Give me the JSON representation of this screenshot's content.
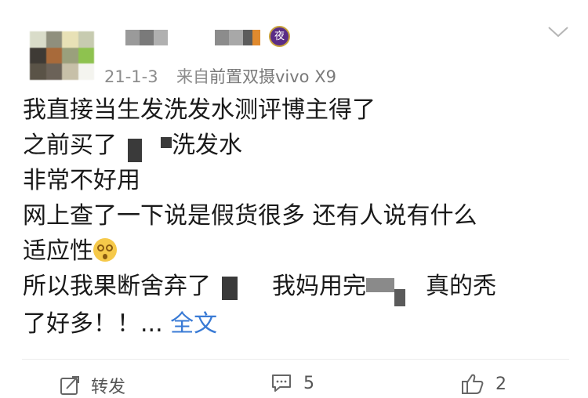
{
  "post": {
    "date": "21-1-3",
    "source_prefix": "来自",
    "source_device": "前置双摄vivo X9",
    "line1": "我直接当生发洗发水测评博主得了",
    "line2_pre": "之前买了",
    "line2_post": "洗发水",
    "line3": "非常不好用",
    "line4": "网上查了一下说是假货很多 还有人说有什么",
    "line5": "适应性",
    "line6_pre": "所以我果断舍弃了",
    "line6_mid": "我妈用完",
    "line6_post": "真的秃",
    "line7_pre": "了好多！！... ",
    "full_text_link": "全文"
  },
  "actions": {
    "repost_label": "转发",
    "comment_count": "5",
    "like_count": "2"
  },
  "icons": {
    "badge": "night-badge-icon",
    "badge_char": "夜",
    "menu": "chevron-down-icon",
    "emoji": "dizzy-face-icon",
    "repost": "repost-icon",
    "comment": "comment-icon",
    "like": "thumbs-up-icon"
  },
  "colors": {
    "link": "#3a7bd5",
    "meta": "#8c8c8c",
    "badge": "#5a2d86"
  }
}
